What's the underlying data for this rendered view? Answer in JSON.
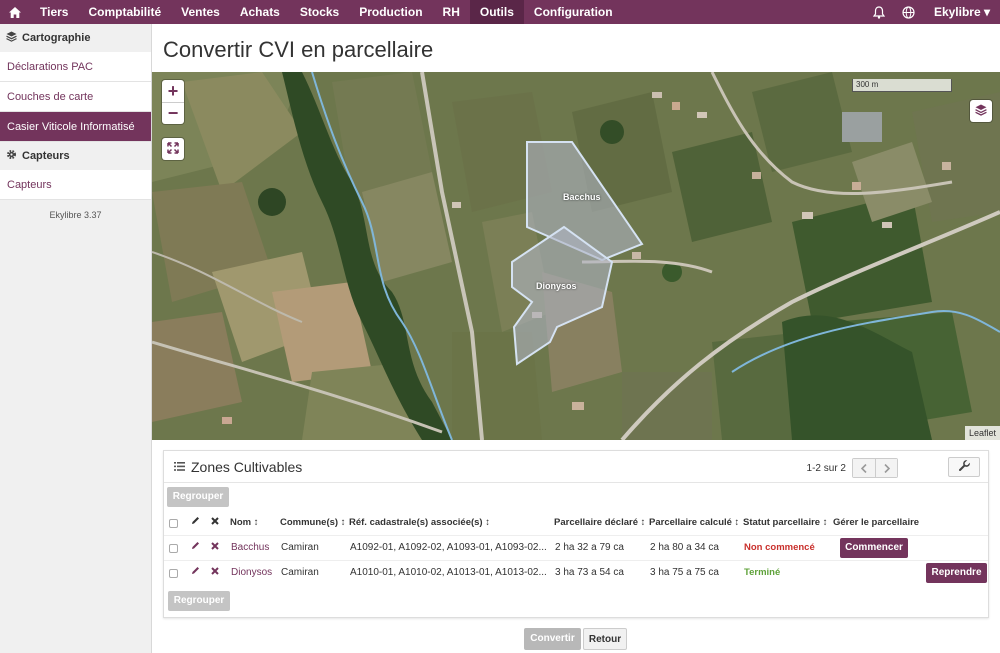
{
  "topnav": {
    "items": [
      {
        "label": "Tiers"
      },
      {
        "label": "Comptabilité"
      },
      {
        "label": "Ventes"
      },
      {
        "label": "Achats"
      },
      {
        "label": "Stocks"
      },
      {
        "label": "Production"
      },
      {
        "label": "RH"
      },
      {
        "label": "Outils"
      },
      {
        "label": "Configuration"
      }
    ],
    "active": "Outils",
    "user": "Ekylibre ▾"
  },
  "sidebar": {
    "sections": [
      {
        "title": "Cartographie",
        "items": [
          "Déclarations PAC",
          "Couches de carte",
          "Casier Viticole Informatisé"
        ]
      },
      {
        "title": "Capteurs",
        "items": [
          "Capteurs"
        ]
      }
    ],
    "active_item": "Casier Viticole Informatisé",
    "version": "Ekylibre 3.37"
  },
  "page": {
    "title": "Convertir CVI en parcellaire"
  },
  "map": {
    "scale": "300 m",
    "attribution": "Leaflet",
    "parcels": [
      "Bacchus",
      "Dionysos"
    ]
  },
  "panel": {
    "title": "Zones Cultivables",
    "pagination": "1-2 sur 2",
    "regroup_label": "Regrouper",
    "columns": [
      "Nom",
      "Commune(s)",
      "Réf. cadastrale(s) associée(s)",
      "Parcellaire déclaré",
      "Parcellaire calculé",
      "Statut parcellaire",
      "Gérer le parcellaire"
    ],
    "rows": [
      {
        "name": "Bacchus",
        "commune": "Camiran",
        "refs": "A1092-01, A1092-02, A1093-01, A1093-02...",
        "declared": "2 ha 32 a 79 ca",
        "computed": "2 ha 80 a 34 ca",
        "status": "Non commencé",
        "action": "Commencer"
      },
      {
        "name": "Dionysos",
        "commune": "Camiran",
        "refs": "A1010-01, A1010-02, A1013-01, A1013-02...",
        "declared": "3 ha 73 a 54 ca",
        "computed": "3 ha 75 a 75 ca",
        "status": "Terminé",
        "action": "Reprendre"
      }
    ]
  },
  "footer": {
    "convert": "Convertir",
    "back": "Retour"
  },
  "colors": {
    "brand": "#73345c",
    "status_not_started": "#c9302c",
    "status_done": "#5fa23a"
  }
}
